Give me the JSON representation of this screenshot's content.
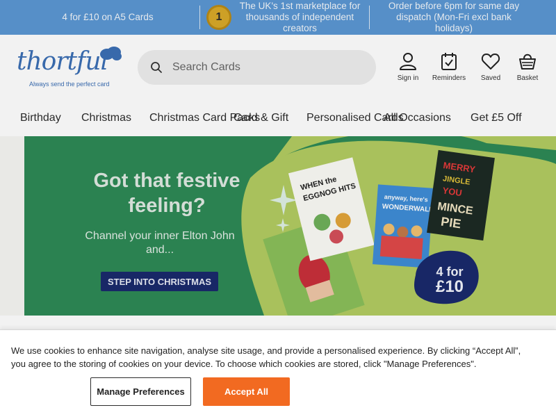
{
  "promo": {
    "left_text": "4 for £10 on A5 Cards",
    "medal_number": "1",
    "middle_text": "The UK's 1st marketplace for thousands of independent creators",
    "right_text": "Order before 6pm for same day dispatch (Mon-Fri excl bank holidays)"
  },
  "header": {
    "logo_text": "thortful",
    "tagline": "Always send the perfect card",
    "search_placeholder": "Search Cards",
    "actions": [
      {
        "label": "Sign in",
        "icon": "user-icon"
      },
      {
        "label": "Reminders",
        "icon": "calendar-check-icon"
      },
      {
        "label": "Saved",
        "icon": "heart-icon"
      },
      {
        "label": "Basket",
        "icon": "basket-icon"
      }
    ]
  },
  "nav": {
    "items": [
      "Birthday",
      "Christmas",
      "Christmas Card Packs",
      "Card & Gift",
      "Personalised Cards",
      "All Occasions",
      "Get £5 Off"
    ]
  },
  "hero": {
    "title": "Got that festive feeling?",
    "subtitle": "Channel your inner Elton John and...",
    "cta": "STEP INTO CHRISTMAS",
    "badge_line1": "4 for",
    "badge_line2": "£10",
    "colors": {
      "green": "#2e8a56",
      "lime": "#b3cc61",
      "navy": "#1a2a6c"
    }
  },
  "cookie": {
    "text": "We use cookies to enhance site navigation, analyse site usage, and provide a personalised experience. By clicking “Accept All”, you agree to the storing of cookies on your device. To choose which cookies are stored, click \"Manage Preferences\".",
    "manage_label": "Manage Preferences",
    "accept_label": "Accept All",
    "accent": "#f26a21"
  }
}
